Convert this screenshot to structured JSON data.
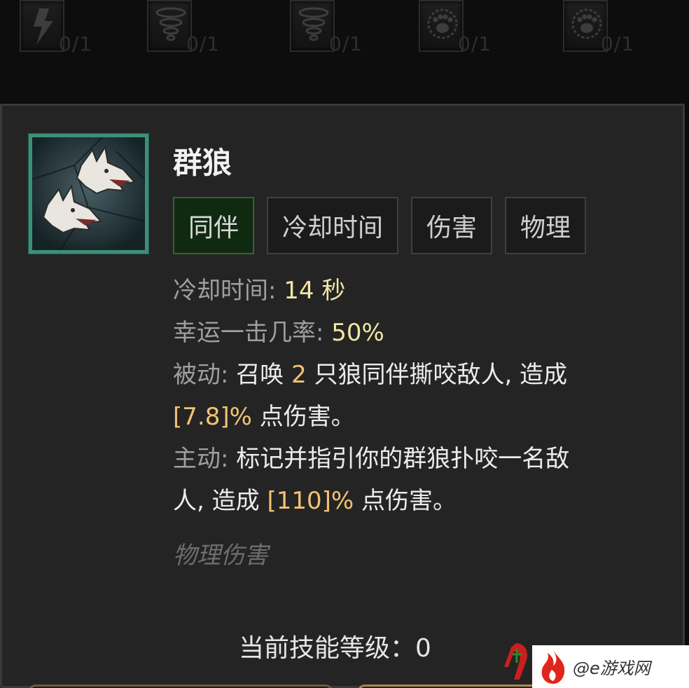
{
  "top_skills": [
    {
      "icon": "lightning-icon",
      "count": "0/1"
    },
    {
      "icon": "tornado-icon",
      "count": "0/1"
    },
    {
      "icon": "tornado-icon",
      "count": "0/1"
    },
    {
      "icon": "paw-icon",
      "count": "0/1"
    },
    {
      "icon": "paw-icon",
      "count": "0/1"
    }
  ],
  "skill": {
    "name": "群狼",
    "icon": "wolf-pack-icon",
    "tags": [
      "同伴",
      "冷却时间",
      "伤害",
      "物理"
    ],
    "cooldown": {
      "label": "冷却时间:",
      "value": "14 秒"
    },
    "lucky_hit": {
      "label": "幸运一击几率:",
      "value": "50%"
    },
    "passive": {
      "label": "被动:",
      "text_1": "召唤",
      "count": "2",
      "text_2": "只狼同伴撕咬敌人, 造成",
      "damage": "[7.8]%",
      "text_3": "点伤害。"
    },
    "active": {
      "label": "主动:",
      "text_1": "标记并指引你的群狼扑咬一名敌",
      "text_2": "人, 造成",
      "damage": "[110]%",
      "text_3": "点伤害。"
    },
    "damage_type": "物理伤害",
    "level_label": "当前技能等级：0"
  },
  "watermark": {
    "text": "@e游戏网"
  },
  "colors": {
    "icon_frame": "#3d8f7a",
    "tag_active_bg": "#0f2a10",
    "value_yellow": "#f0e6a6",
    "value_orange": "#f2c272"
  }
}
